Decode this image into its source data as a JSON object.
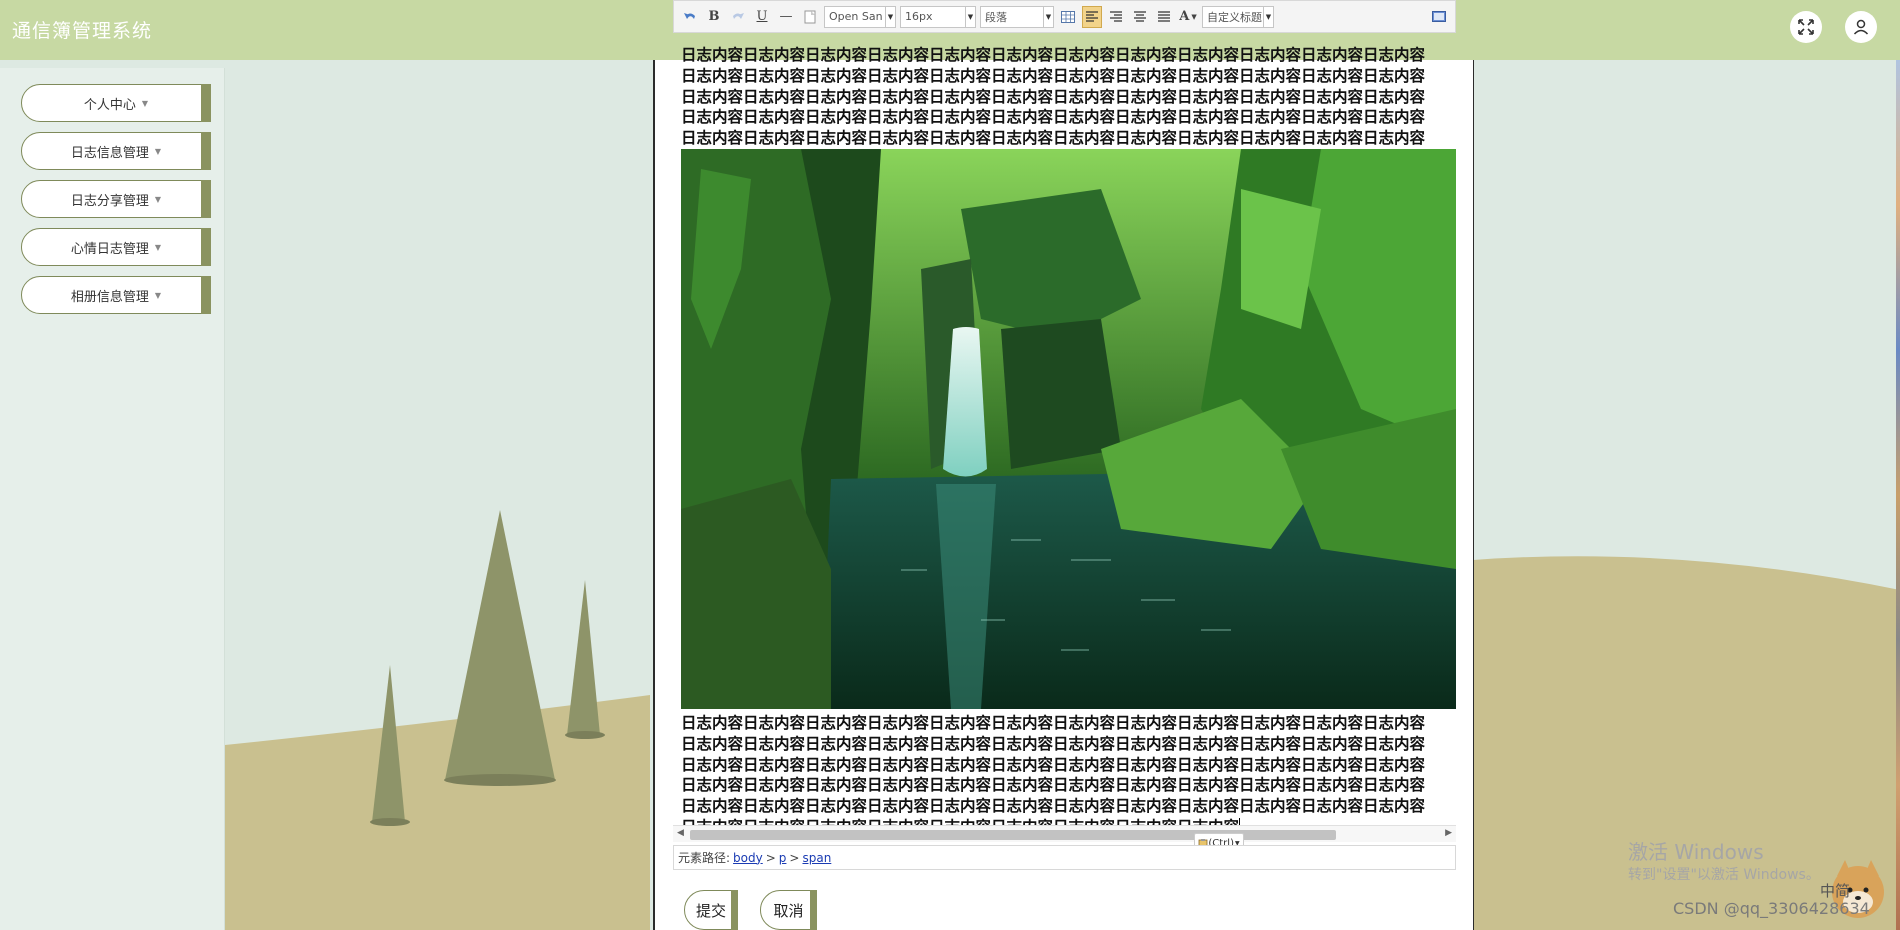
{
  "header": {
    "app_title": "通信簿管理系统",
    "fullscreen_icon": "fullscreen-icon",
    "user_icon": "user-icon"
  },
  "sidebar": {
    "items": [
      {
        "label": "个人中心"
      },
      {
        "label": "日志信息管理"
      },
      {
        "label": "日志分享管理"
      },
      {
        "label": "心情日志管理"
      },
      {
        "label": "相册信息管理"
      }
    ]
  },
  "editor": {
    "toolbar": {
      "undo_icon": "undo-icon",
      "bold_label": "B",
      "redo_icon": "redo-icon",
      "underline_label": "U",
      "hr_label": "—",
      "font_family": "Open San",
      "font_size": "16px",
      "paragraph": "段落",
      "text_color_label": "A",
      "custom_heading": "自定义标题"
    },
    "paragraph_1": "日志内容日志内容日志内容日志内容日志内容日志内容日志内容日志内容日志内容日志内容日志内容日志内容日志内容日志内容日志内容日志内容日志内容日志内容日志内容日志内容日志内容日志内容日志内容日志内容日志内容日志内容日志内容日志内容日志内容日志内容日志内容日志内容日志内容日志内容日志内容日志内容日志内容日志内容日志内容日志内容日志内容日志内容日志内容日志内容日志内容日志内容日志内容日志内容日志内容日志内容日志内容日志内容日志内容日志内容日志内容日志内容日志内容日志内容日志内容日志内容日志内容日志内容日志内容日志内容日志内容日志内容日志内容日志内容",
    "paragraph_2": "日志内容日志内容日志内容日志内容日志内容日志内容日志内容日志内容日志内容日志内容日志内容日志内容日志内容日志内容日志内容日志内容日志内容日志内容日志内容日志内容日志内容日志内容日志内容日志内容日志内容日志内容日志内容日志内容日志内容日志内容日志内容日志内容日志内容日志内容日志内容日志内容日志内容日志内容日志内容日志内容日志内容日志内容日志内容日志内容日志内容日志内容日志内容日志内容日志内容日志内容日志内容日志内容日志内容日志内容日志内容日志内容日志内容日志内容日志内容日志内容日志内容日志内容日志内容日志内容日志内容日志内容日志内容日志内容日志内容",
    "paste_badge": "(Ctrl)",
    "path": {
      "label": "元素路径:",
      "segments": [
        "body",
        "p",
        "span"
      ],
      "separator": ">"
    }
  },
  "actions": {
    "submit_label": "提交",
    "cancel_label": "取消"
  },
  "overlay": {
    "activate_title": "激活 Windows",
    "activate_hint": "转到\"设置\"以激活 Windows。",
    "csdn_watermark": "CSDN @qq_3306428634",
    "ime_label": "中简"
  },
  "colors": {
    "header_bg": "#c7d9a3",
    "accent": "#8a9360",
    "hill": "#c9c08f",
    "tree": "#8e9469"
  }
}
